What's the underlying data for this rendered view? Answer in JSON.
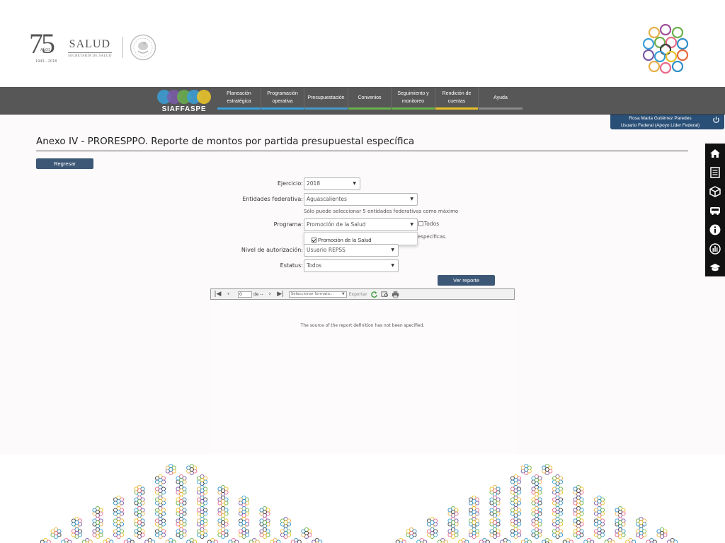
{
  "header": {
    "logo_75": {
      "number": "75",
      "anos": "AÑOS",
      "years": "1943 - 2018"
    },
    "logo_salud": {
      "name": "SALUD",
      "subtitle": "SECRETARÍA DE SALUD"
    }
  },
  "nav": {
    "brand": "SIAFFASPE",
    "items": [
      {
        "label": "Planeación estratégica",
        "color": "#3aa0d8"
      },
      {
        "label": "Programación operativa",
        "color": "#3aa0d8"
      },
      {
        "label": "Presupuestación",
        "color": "#9a9a9a"
      },
      {
        "label": "Convenios",
        "color": "#6ab04c"
      },
      {
        "label": "Seguimiento y monitoreo",
        "color": "#6ab04c"
      },
      {
        "label": "Rendición de cuentas",
        "color": "#e8c22a"
      },
      {
        "label": "Ayuda",
        "color": "#8a8a8a"
      }
    ]
  },
  "user": {
    "name": "Rosa María Gutiérrez Paredes",
    "role": "Usuario Federal (Apoyo Líder Federal)"
  },
  "page": {
    "title": "Anexo IV - PRORESPPO. Reporte de montos por partida presupuestal específica",
    "back_button": "Regresar",
    "report_button": "Ver reporte"
  },
  "form": {
    "ejercicio": {
      "label": "Ejercicio:",
      "value": "2018"
    },
    "entidades": {
      "label": "Entidades federativa:",
      "value": "Aguascalientes",
      "hint": "Sólo puede seleccionar 5 entidades federativas como máximo"
    },
    "programa": {
      "label": "Programa:",
      "value": "Promoción de la Salud",
      "todos_label": "Todos",
      "hint_suffix": "específicas.",
      "dropdown_option": "Promoción de la Salud"
    },
    "nivel": {
      "label": "Nivel de autorización:",
      "value": "Usuario REPSS"
    },
    "estatus": {
      "label": "Estatus:",
      "value": "Todos"
    }
  },
  "viewer": {
    "page_value": "0",
    "of_label": "de --",
    "format_placeholder": "Seleccionar formato...",
    "export_label": "Exportar",
    "message": "The source of the report definition has not been specified."
  },
  "sidebar": {
    "icons": [
      "home-icon",
      "document-list-icon",
      "box-icon",
      "vehicle-icon",
      "info-icon",
      "chart-icon",
      "graduation-cap-icon"
    ]
  },
  "colors": {
    "nav_bg": "#575757",
    "button_bg": "#3d5877",
    "user_badge_bg": "#2a4f76",
    "sidebar_bg": "#111111"
  }
}
